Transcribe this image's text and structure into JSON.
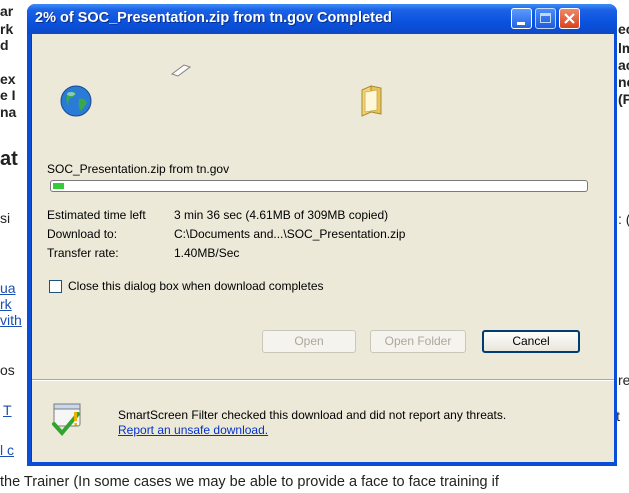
{
  "background_page": {
    "fragments": [
      {
        "text": "ar",
        "style": "bold"
      },
      {
        "text": "rk",
        "style": "bold"
      },
      {
        "text": "d",
        "style": "bold"
      },
      {
        "text": "ex",
        "style": "bold"
      },
      {
        "text": "e I",
        "style": "bold"
      },
      {
        "text": "na",
        "style": "bold"
      },
      {
        "text": "at",
        "style": "bold"
      },
      {
        "text": "si",
        "style": "norm"
      },
      {
        "text": "ua",
        "style": "link"
      },
      {
        "text": "rk",
        "style": "link"
      },
      {
        "text": "vith",
        "style": "link"
      },
      {
        "text": "os",
        "style": "norm"
      },
      {
        "text": "T",
        "style": "link"
      },
      {
        "text": "l c",
        "style": "link"
      },
      {
        "text": "eci",
        "style": "bold"
      },
      {
        "text": "lmi",
        "style": "bold"
      },
      {
        "text": "acti",
        "style": "bold"
      },
      {
        "text": "ne",
        "style": "bold"
      },
      {
        "text": "(Plo",
        "style": "bold"
      },
      {
        "text": ": (c",
        "style": "norm"
      },
      {
        "text": "rea",
        "style": "norm"
      },
      {
        "text": "it",
        "style": "norm"
      }
    ],
    "bottom_line": "the Trainer (In some cases we may be able to provide a face to face training if"
  },
  "dialog": {
    "title": "2% of SOC_Presentation.zip from tn.gov Completed",
    "file_source": "SOC_Presentation.zip from tn.gov",
    "progress_fraction": 0.02,
    "rows": [
      {
        "label": "Estimated time left",
        "value": "3 min 36 sec (4.61MB of 309MB copied)"
      },
      {
        "label": "Download to:",
        "value": "C:\\Documents and...\\SOC_Presentation.zip"
      },
      {
        "label": "Transfer rate:",
        "value": "1.40MB/Sec"
      }
    ],
    "close_checkbox_label": "Close this dialog box when download completes",
    "close_checkbox_checked": false,
    "buttons": {
      "open": "Open",
      "open_folder": "Open Folder",
      "cancel": "Cancel"
    },
    "smartscreen_text": "SmartScreen Filter checked this download and did not report any threats.",
    "smartscreen_link": "Report an unsafe download."
  },
  "colors": {
    "title_bar": "#0a52de",
    "progress": "#36c93a",
    "client": "#ece9d8",
    "link": "#0033cc"
  }
}
